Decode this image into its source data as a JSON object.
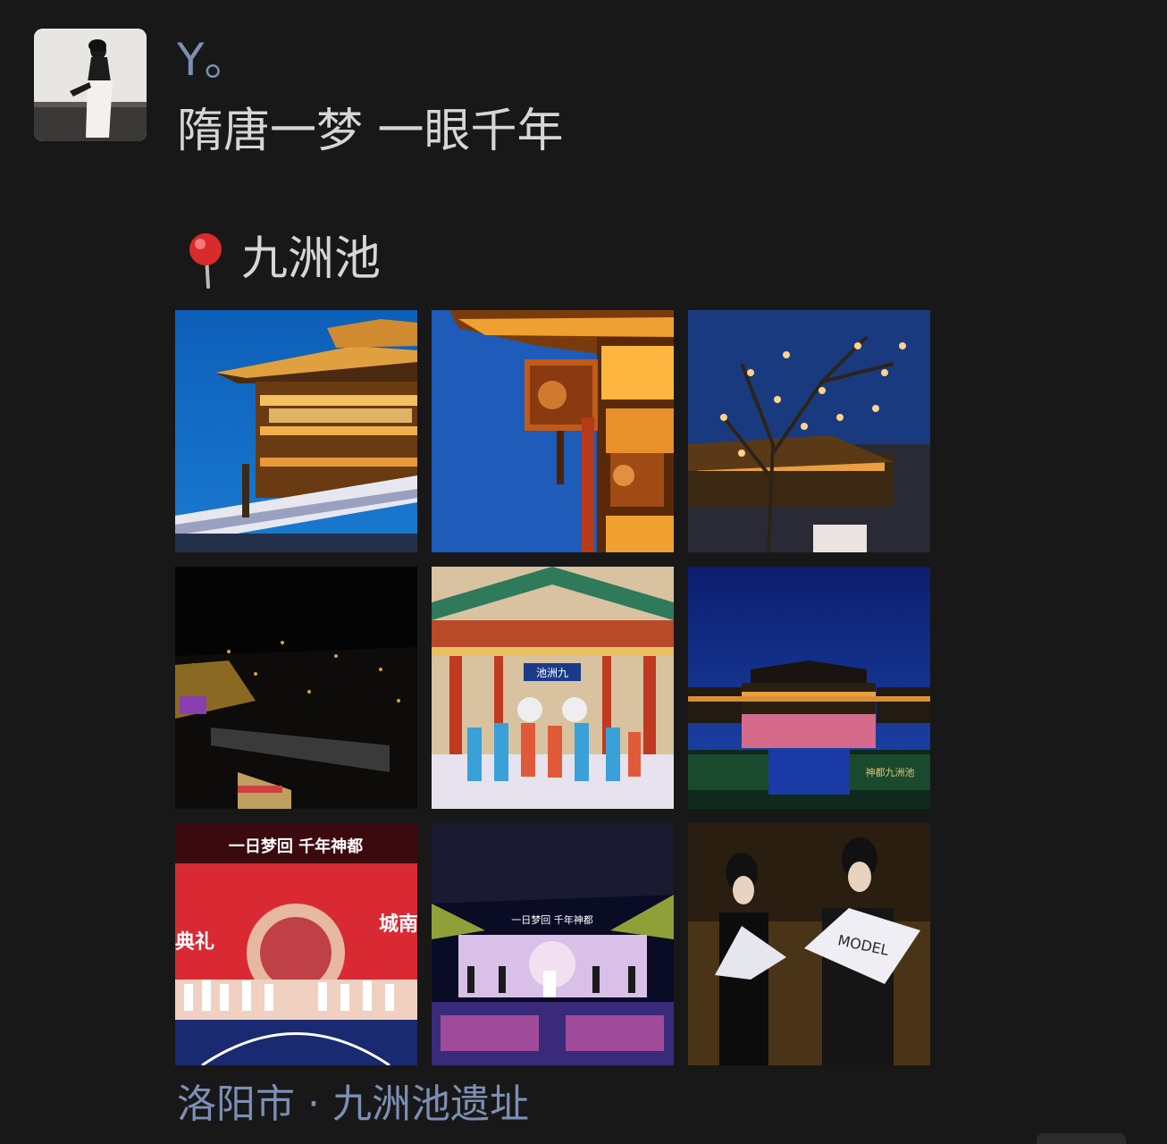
{
  "post": {
    "username": "Y。",
    "text": "隋唐一梦 一眼千年",
    "pin_emoji": "pin-icon",
    "pin_label": "九洲池",
    "location": "洛阳市 · 九洲池遗址"
  },
  "photos": {
    "p7": {
      "banner": "一日梦回 千年神都",
      "sign_left": "典礼",
      "sign_right": "城南"
    },
    "p5": {
      "plaque": "池洲九"
    },
    "p6": {
      "banner": "神都九洲池"
    },
    "p8": {
      "banner": "一日梦回 千年神都"
    },
    "p9": {
      "fan_text": "MODEL"
    }
  },
  "colors": {
    "background": "#181818",
    "username": "#7d8fb4",
    "text": "#d6d6d6",
    "location": "#7d8fb4"
  }
}
